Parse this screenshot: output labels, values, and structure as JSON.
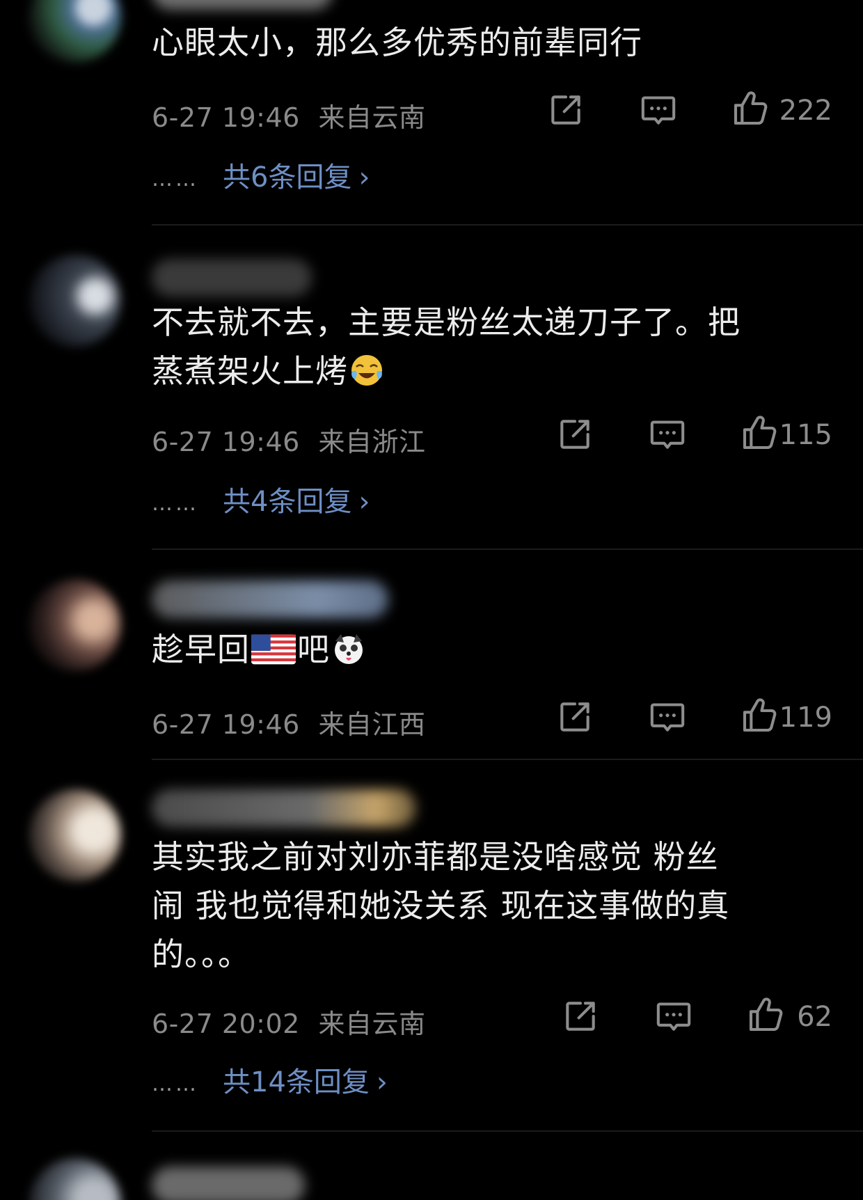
{
  "comments": [
    {
      "text": "心眼太小，那么多优秀的前辈同行",
      "time": "6-27 19:46",
      "location": "来自云南",
      "likes": "222",
      "replies_label": "共6条回复"
    },
    {
      "text_line1": "不去就不去，主要是粉丝太递刀子了。把",
      "text_line2": "蒸煮架火上烤",
      "emoji": "crying-laughing-emoji",
      "time": "6-27 19:46",
      "location": "来自浙江",
      "likes": "115",
      "replies_label": "共4条回复"
    },
    {
      "text_part1": "趁早回",
      "text_part2": "吧",
      "emoji1": "us-flag-emoji",
      "emoji2": "dog-face-emoji",
      "time": "6-27 19:46",
      "location": "来自江西",
      "likes": "119"
    },
    {
      "text_line1": "其实我之前对刘亦菲都是没啥感觉 粉丝",
      "text_line2": "闹 我也觉得和她没关系 现在这事做的真",
      "text_line3": "的。。。",
      "time": "6-27 20:02",
      "location": "来自云南",
      "likes": "62",
      "replies_label": "共14条回复"
    }
  ],
  "ellipsis": "……",
  "chevron": "›",
  "icons": {
    "share": "share-icon",
    "comment": "comment-icon",
    "like": "thumbs-up-icon"
  },
  "colors": {
    "background": "#000000",
    "text": "#ececec",
    "meta": "#8a8a8a",
    "link": "#6e8fc4"
  }
}
